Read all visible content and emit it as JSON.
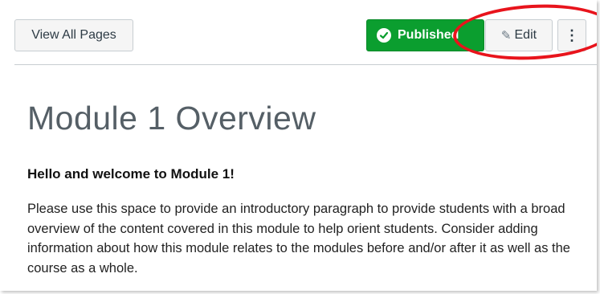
{
  "toolbar": {
    "view_all_label": "View All Pages",
    "published_label": "Published",
    "edit_label": "Edit",
    "more_label": "⋮"
  },
  "page": {
    "title": "Module 1 Overview",
    "heading": "Hello and welcome to Module 1!",
    "paragraph": "Please use this space to provide an introductory paragraph to provide students with a broad overview of the content covered in this module to help orient students. Consider adding information about how this module relates to the modules before and/or after it as well as the course as a whole."
  },
  "icons": {
    "published": "check-circle-icon",
    "edit": "pencil-icon",
    "more": "more-vertical-icon"
  },
  "colors": {
    "published_green": "#0b9e2f",
    "highlight_red": "#e8141c",
    "button_bg": "#f5f5f5",
    "text": "#2d3b45"
  }
}
